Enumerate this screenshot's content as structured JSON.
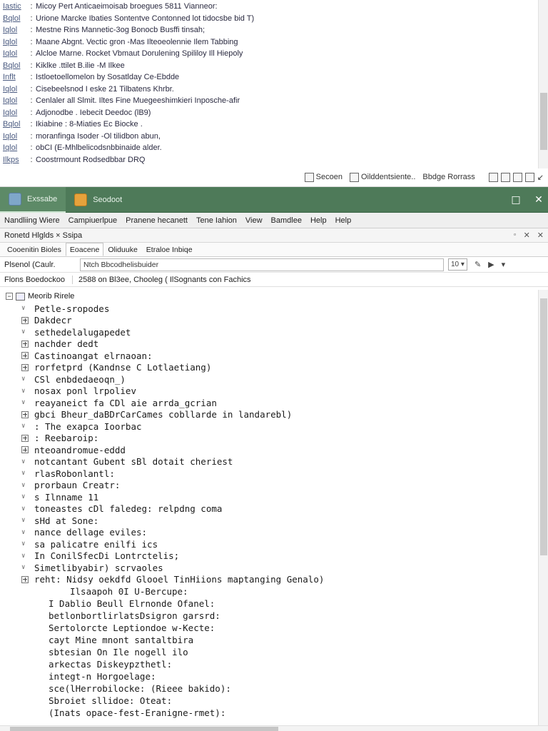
{
  "log_panel": {
    "rows": [
      {
        "tag": "Iastic",
        "text": "Micoy Pert Anticaeimoisab broegues 5811 Vianneor:"
      },
      {
        "tag": "Bqlol",
        "text": "Urione Marcke Ibaties Sontentve Contonned lot tidocsbe bid T)"
      },
      {
        "tag": "Iqlol",
        "text": "Mestne  Rins  Mannetic-3og  Bonocb  Busffi tinsah;"
      },
      {
        "tag": "Iqlol",
        "text": "Maane  Abgnt. Vectic  gron  -Mas  Ilteoeolennie Ilem Tabbing"
      },
      {
        "tag": "Iqlol",
        "text": "Alcloe  Marne. Rocket Vbmaut  Dorulening Spililoy  Ill Hiepoly"
      },
      {
        "tag": "Bqlol",
        "text": "Kiklke  .ttilet B.ilie  -M  Ilkee"
      },
      {
        "tag": "Inflt",
        "text": "Istloetoellomelon  by  Sosatlday  Ce-Ebdde"
      },
      {
        "tag": "Iqlol",
        "text": "Cisebeelsnod  I eske  21 Tilbatens  Khrbr."
      },
      {
        "tag": "Iqlol",
        "text": "Cenlaler  all Slmit. Iltes  Fine  Muegeeshimkieri  Inposche-afir"
      },
      {
        "tag": "Iqlol",
        "text": "Adjonodbe . Iebecit  Deedoc  (lB9)"
      },
      {
        "tag": "Bqlol",
        "text": "Ikiabine : 8-Miaties  Ec Biocke ."
      },
      {
        "tag": "Iqlol",
        "text": "moranfinga Isoder  -Ol tilidbon  abun,"
      },
      {
        "tag": "Iqlol",
        "text": "obCI  (E-Mhlbelicodsnbbinaide  alder."
      },
      {
        "tag": "Ilkps",
        "text": "Coostrmount  Rodsedbbar  DRQ"
      }
    ],
    "toolbar": {
      "screen_label": "Secoen",
      "orient_label": "Oilddentsiente..",
      "progress_label": "Bbdge  Rorrass"
    }
  },
  "window": {
    "tabs": [
      {
        "label": "Exssabe"
      },
      {
        "label": "Seodoot"
      }
    ],
    "menu": [
      "Nandliing Wiere",
      "Campiuerlpue",
      "Pranene hecanett",
      "Tene Iahion",
      "View",
      "Bamdlee",
      "Help",
      "Help"
    ],
    "panel_title": "Ronetd Hlglds × Ssipa",
    "sub_tabs": [
      "Cooenitin Bioles",
      "Eoacene",
      "Oliduuke",
      "Etraloe Inbiqe"
    ],
    "filter": {
      "label": "Plsenol (Caulr.",
      "value": "Ntch Bbcodhelisbuider",
      "count": "10"
    },
    "status": {
      "label": "Flons Boedockoo",
      "text": "2588 on Bl3ee, Chooleg ( IlSognants con Fachics"
    },
    "tree": {
      "root_label": "Meorib Rirele",
      "rows": [
        {
          "kind": "chev",
          "text": "Petle-sropodes"
        },
        {
          "kind": "plus",
          "text": "Dakdecr"
        },
        {
          "kind": "chev",
          "text": "sethedelalugapedet"
        },
        {
          "kind": "plus",
          "text": "nachder dedt"
        },
        {
          "kind": "plus",
          "text": "Castinoangat elrnaoan:"
        },
        {
          "kind": "plus",
          "text": "rorfetprd (Kandnse C Lotlaetiang)"
        },
        {
          "kind": "chev",
          "text": "CSl enbdedaeoqn_)"
        },
        {
          "kind": "chev",
          "text": "nosax ponl lrpoliev"
        },
        {
          "kind": "chev",
          "text": "reayaneict fa CDl aie arrda_gcrian"
        },
        {
          "kind": "plus",
          "text": "gbci Bheur_daBDrCarCames cobllarde in landarebl)"
        },
        {
          "kind": "chev",
          "text": ": The exapca Ioorbac"
        },
        {
          "kind": "plus",
          "text": ": Reebaroip:"
        },
        {
          "kind": "plus",
          "text": "nteoandromue-eddd"
        },
        {
          "kind": "chev",
          "text": "notcantant Gubent sBl dotait cheriest"
        },
        {
          "kind": "chev",
          "text": "rlasRobonlantl:"
        },
        {
          "kind": "chev",
          "text": "prorbaun Creatr:"
        },
        {
          "kind": "chev",
          "text": "s Ilnname 11"
        },
        {
          "kind": "chev",
          "text": "toneastes cDl faledeg: relpdng coma"
        },
        {
          "kind": "chev",
          "text": "sHd at Sone:"
        },
        {
          "kind": "chev",
          "text": "nance dellage eviles:"
        },
        {
          "kind": "chev",
          "text": "sa palicatre enilfi ics"
        },
        {
          "kind": "chev",
          "text": "In ConilSfecDi Lontrctelis;"
        },
        {
          "kind": "chev",
          "text": "Simetlibyabir) scrvaoles"
        },
        {
          "kind": "plus",
          "text": "reht: Nidsy oekdfd Glooel TinHiions maptanging Genalo)"
        }
      ],
      "details": [
        {
          "sub": true,
          "text": "Ilsaapoh 0I U-Bercupe:"
        },
        {
          "sub": false,
          "text": "I Dablio Beull Elrnonde Ofanel:"
        },
        {
          "sub": false,
          "text": "betlonbortlirlatsDsigron garsrd:"
        },
        {
          "sub": false,
          "text": "Sertolorcte Leptiondoe w-Kecte:"
        },
        {
          "sub": false,
          "text": "cayt Mine mnont santaltbira"
        },
        {
          "sub": false,
          "text": "sbtesian On Ile nogell ilo"
        },
        {
          "sub": false,
          "text": "arkectas Diskeypzthetl:"
        },
        {
          "sub": false,
          "text": "integt-n Horgoelage:"
        },
        {
          "sub": false,
          "text": "sce(lHerrobilocke: (Rieee bakido):"
        },
        {
          "sub": false,
          "text": "Sbroiet sllidoe: Oteat:"
        },
        {
          "sub": false,
          "text": "(Inats opace-fest-Eranigne-rmet):"
        }
      ]
    }
  },
  "colors": {
    "title_bar": "#4e7a59",
    "active_tab": "#5d8a67"
  }
}
